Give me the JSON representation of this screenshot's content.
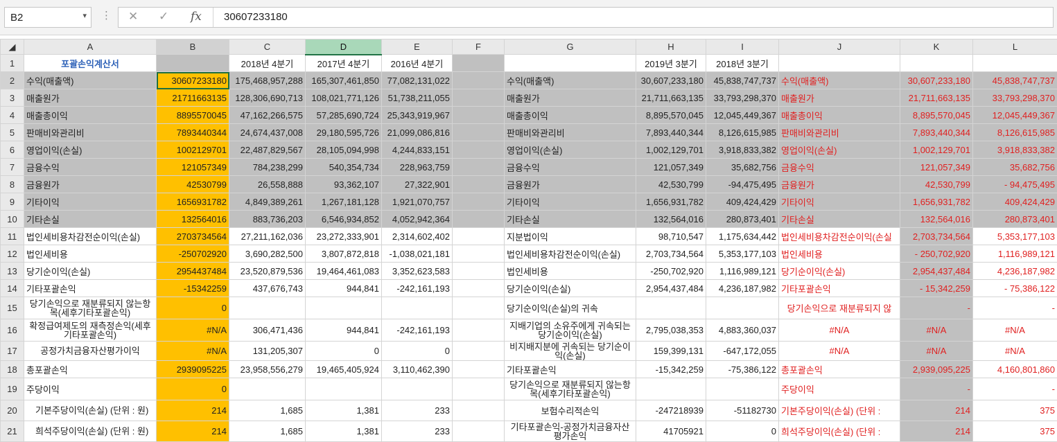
{
  "formula_bar": {
    "name_box": "B2",
    "formula_value": "30607233180",
    "cancel_symbol": "✕",
    "enter_symbol": "✓",
    "fx_symbol": "fx"
  },
  "columns": [
    "A",
    "B",
    "C",
    "D",
    "E",
    "F",
    "G",
    "H",
    "I",
    "J",
    "K",
    "L"
  ],
  "colors": {
    "gray_fill": "#c0c0c0",
    "orange_fill": "#ffc000",
    "red_text": "#e02020",
    "header_blue": "#2e62b8"
  },
  "rows": [
    {
      "n": "1",
      "A": "포괄손익계산서",
      "B": "",
      "C": "2018년 4분기",
      "D": "2017년 4분기",
      "E": "2016년 4분기",
      "F": "",
      "G": "",
      "H": "2019년 3분기",
      "I": "2018년 3분기",
      "J": "",
      "K": "",
      "L": ""
    },
    {
      "n": "2",
      "A": "수익(매출액)",
      "B": "30607233180",
      "C": "175,468,957,288",
      "D": "165,307,461,850",
      "E": "77,082,131,022",
      "F": "",
      "G": "수익(매출액)",
      "H": "30,607,233,180",
      "I": "45,838,747,737",
      "J": "수익(매출액)",
      "K": "30,607,233,180",
      "L": "45,838,747,737"
    },
    {
      "n": "3",
      "A": "매출원가",
      "B": "21711663135",
      "C": "128,306,690,713",
      "D": "108,021,771,126",
      "E": "51,738,211,055",
      "F": "",
      "G": "매출원가",
      "H": "21,711,663,135",
      "I": "33,793,298,370",
      "J": "매출원가",
      "K": "21,711,663,135",
      "L": "33,793,298,370"
    },
    {
      "n": "4",
      "A": "매출총이익",
      "B": "8895570045",
      "C": "47,162,266,575",
      "D": "57,285,690,724",
      "E": "25,343,919,967",
      "F": "",
      "G": "매출총이익",
      "H": "8,895,570,045",
      "I": "12,045,449,367",
      "J": "매출총이익",
      "K": "8,895,570,045",
      "L": "12,045,449,367"
    },
    {
      "n": "5",
      "A": "판매비와관리비",
      "B": "7893440344",
      "C": "24,674,437,008",
      "D": "29,180,595,726",
      "E": "21,099,086,816",
      "F": "",
      "G": "판매비와관리비",
      "H": "7,893,440,344",
      "I": "8,126,615,985",
      "J": "판매비와관리비",
      "K": "7,893,440,344",
      "L": "8,126,615,985"
    },
    {
      "n": "6",
      "A": "영업이익(손실)",
      "B": "1002129701",
      "C": "22,487,829,567",
      "D": "28,105,094,998",
      "E": "4,244,833,151",
      "F": "",
      "G": "영업이익(손실)",
      "H": "1,002,129,701",
      "I": "3,918,833,382",
      "J": "영업이익(손실)",
      "K": "1,002,129,701",
      "L": "3,918,833,382"
    },
    {
      "n": "7",
      "A": "금융수익",
      "B": "121057349",
      "C": "784,238,299",
      "D": "540,354,734",
      "E": "228,963,759",
      "F": "",
      "G": "금융수익",
      "H": "121,057,349",
      "I": "35,682,756",
      "J": "금융수익",
      "K": "121,057,349",
      "L": "35,682,756"
    },
    {
      "n": "8",
      "A": "금융원가",
      "B": "42530799",
      "C": "26,558,888",
      "D": "93,362,107",
      "E": "27,322,901",
      "F": "",
      "G": "금융원가",
      "H": "42,530,799",
      "I": "-94,475,495",
      "J": "금융원가",
      "K": "42,530,799",
      "L": "-     94,475,495"
    },
    {
      "n": "9",
      "A": "기타이익",
      "B": "1656931782",
      "C": "4,849,389,261",
      "D": "1,267,181,128",
      "E": "1,921,070,757",
      "F": "",
      "G": "기타이익",
      "H": "1,656,931,782",
      "I": "409,424,429",
      "J": "기타이익",
      "K": "1,656,931,782",
      "L": "409,424,429"
    },
    {
      "n": "10",
      "A": "기타손실",
      "B": "132564016",
      "C": "883,736,203",
      "D": "6,546,934,852",
      "E": "4,052,942,364",
      "F": "",
      "G": "기타손실",
      "H": "132,564,016",
      "I": "280,873,401",
      "J": "기타손실",
      "K": "132,564,016",
      "L": "280,873,401"
    },
    {
      "n": "11",
      "A": "법인세비용차감전순이익(손실)",
      "B": "2703734564",
      "C": "27,211,162,036",
      "D": "23,272,333,901",
      "E": "2,314,602,402",
      "F": "",
      "G": "지분법이익",
      "H": "98,710,547",
      "I": "1,175,634,442",
      "J": "법인세비용차감전순이익(손실",
      "K": "2,703,734,564",
      "L": "5,353,177,103"
    },
    {
      "n": "12",
      "A": "법인세비용",
      "B": "-250702920",
      "C": "3,690,282,500",
      "D": "3,807,872,818",
      "E": "-1,038,021,181",
      "F": "",
      "G": "법인세비용차감전순이익(손실)",
      "H": "2,703,734,564",
      "I": "5,353,177,103",
      "J": "법인세비용",
      "K": "-     250,702,920",
      "L": "1,116,989,121"
    },
    {
      "n": "13",
      "A": "당기순이익(손실)",
      "B": "2954437484",
      "C": "23,520,879,536",
      "D": "19,464,461,083",
      "E": "3,352,623,583",
      "F": "",
      "G": "법인세비용",
      "H": "-250,702,920",
      "I": "1,116,989,121",
      "J": "당기순이익(손실)",
      "K": "2,954,437,484",
      "L": "4,236,187,982"
    },
    {
      "n": "14",
      "A": "기타포괄손익",
      "B": "-15342259",
      "C": "437,676,743",
      "D": "944,841",
      "E": "-242,161,193",
      "F": "",
      "G": "당기순이익(손실)",
      "H": "2,954,437,484",
      "I": "4,236,187,982",
      "J": "기타포괄손익",
      "K": "-       15,342,259",
      "L": "-      75,386,122"
    },
    {
      "n": "15",
      "A": "당기손익으로 재분류되지 않는항목(세후기타포괄손익)",
      "B": "0",
      "C": "",
      "D": "",
      "E": "",
      "F": "",
      "G": "당기순이익(손실)의 귀속",
      "H": "",
      "I": "",
      "J": "당기손익으로 재분류되지 않",
      "K": "-",
      "L": "-"
    },
    {
      "n": "16",
      "A": "확정급여제도의 재측정손익(세후기타포괄손익)",
      "B": "#N/A",
      "C": "306,471,436",
      "D": "944,841",
      "E": "-242,161,193",
      "F": "",
      "G": "지배기업의 소유주에게 귀속되는 당기순이익(손실)",
      "H": "2,795,038,353",
      "I": "4,883,360,037",
      "J": "#N/A",
      "K": "#N/A",
      "L": "#N/A"
    },
    {
      "n": "17",
      "A": "공정가치금융자산평가이익",
      "B": "#N/A",
      "C": "131,205,307",
      "D": "0",
      "E": "0",
      "F": "",
      "G": "비지배지분에 귀속되는 당기순이익(손실)",
      "H": "159,399,131",
      "I": "-647,172,055",
      "J": "#N/A",
      "K": "#N/A",
      "L": "#N/A"
    },
    {
      "n": "18",
      "A": "총포괄손익",
      "B": "2939095225",
      "C": "23,958,556,279",
      "D": "19,465,405,924",
      "E": "3,110,462,390",
      "F": "",
      "G": "기타포괄손익",
      "H": "-15,342,259",
      "I": "-75,386,122",
      "J": "총포괄손익",
      "K": "2,939,095,225",
      "L": "4,160,801,860"
    },
    {
      "n": "19",
      "A": "주당이익",
      "B": "0",
      "C": "",
      "D": "",
      "E": "",
      "F": "",
      "G": "당기손익으로 재분류되지 않는항목(세후기타포괄손익)",
      "H": "",
      "I": "",
      "J": "주당이익",
      "K": "-",
      "L": "-"
    },
    {
      "n": "20",
      "A": "기본주당이익(손실) (단위 : 원)",
      "B": "214",
      "C": "1,685",
      "D": "1,381",
      "E": "233",
      "F": "",
      "G": "보험수리적손익",
      "H": "-247218939",
      "I": "-51182730",
      "J": "기본주당이익(손실) (단위 :",
      "K": "214",
      "L": "375"
    },
    {
      "n": "21",
      "A": "희석주당이익(손실) (단위 : 원)",
      "B": "214",
      "C": "1,685",
      "D": "1,381",
      "E": "233",
      "F": "",
      "G": "기타포괄손익-공정가치금융자산평가손익",
      "H": "41705921",
      "I": "0",
      "J": "희석주당이익(손실) (단위 :",
      "K": "214",
      "L": "375"
    }
  ]
}
